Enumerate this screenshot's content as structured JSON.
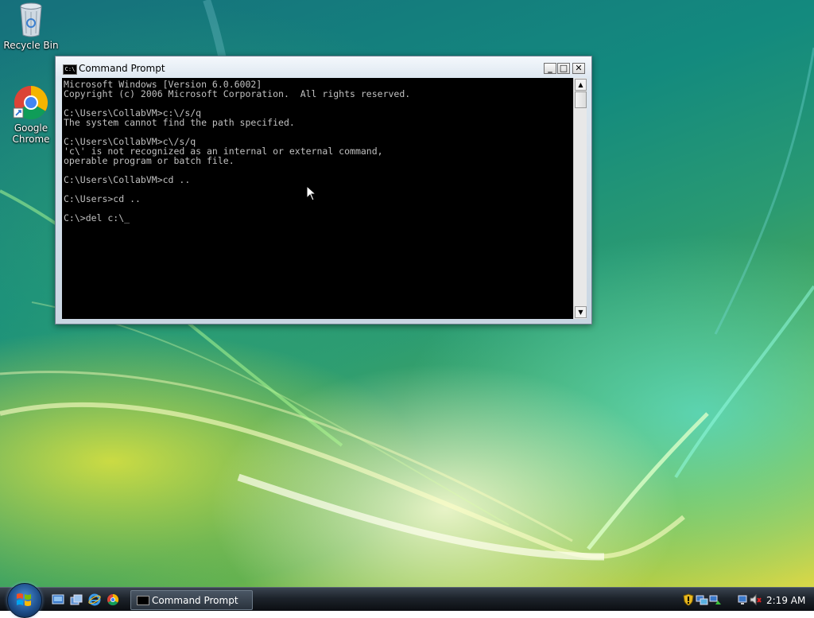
{
  "desktop": {
    "icons": [
      {
        "label": "Recycle Bin",
        "icon": "recycle-bin-icon"
      },
      {
        "label": "Google\nChrome",
        "icon": "chrome-icon"
      }
    ]
  },
  "window": {
    "title": "Command Prompt",
    "icon": "cmd-icon",
    "console_lines": [
      "Microsoft Windows [Version 6.0.6002]",
      "Copyright (c) 2006 Microsoft Corporation.  All rights reserved.",
      "",
      "C:\\Users\\CollabVM>c:\\/s/q",
      "The system cannot find the path specified.",
      "",
      "C:\\Users\\CollabVM>c\\/s/q",
      "'c\\' is not recognized as an internal or external command,",
      "operable program or batch file.",
      "",
      "C:\\Users\\CollabVM>cd ..",
      "",
      "C:\\Users>cd ..",
      "",
      "C:\\>del c:\\_"
    ],
    "controls": {
      "minimize": "_",
      "maximize": "□",
      "close": "✕"
    }
  },
  "taskbar": {
    "start": "windows-logo-icon",
    "quick_launch": [
      "show-desktop-icon",
      "switch-windows-icon",
      "internet-explorer-icon",
      "chrome-icon"
    ],
    "tasks": [
      {
        "label": "Command Prompt",
        "icon": "cmd-icon"
      }
    ],
    "tray_icons": [
      "security-shield-icon",
      "network-icon",
      "network-icon",
      "network-icon",
      "volume-muted-icon"
    ],
    "clock": "2:19 AM"
  }
}
